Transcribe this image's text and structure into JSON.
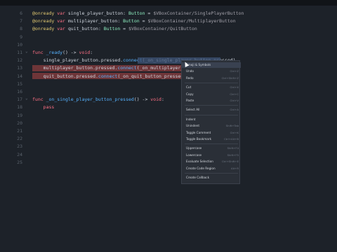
{
  "code_lines": [
    {
      "n": "6",
      "tokens": [
        {
          "c": "ann",
          "t": "@onready"
        },
        {
          "c": "sym",
          "t": " "
        },
        {
          "c": "kw",
          "t": "var"
        },
        {
          "c": "sym",
          "t": " single_player_button: "
        },
        {
          "c": "ty",
          "t": "Button"
        },
        {
          "c": "sym",
          "t": " = "
        },
        {
          "c": "str",
          "t": "$VBoxContainer/SinglePlayerButton"
        }
      ]
    },
    {
      "n": "7",
      "tokens": [
        {
          "c": "ann",
          "t": "@onready"
        },
        {
          "c": "sym",
          "t": " "
        },
        {
          "c": "kw",
          "t": "var"
        },
        {
          "c": "sym",
          "t": " multiplayer_button: "
        },
        {
          "c": "ty",
          "t": "Button"
        },
        {
          "c": "sym",
          "t": " = "
        },
        {
          "c": "str",
          "t": "$VBoxContainer/MultiplayerButton"
        }
      ]
    },
    {
      "n": "8",
      "tokens": [
        {
          "c": "ann",
          "t": "@onready"
        },
        {
          "c": "sym",
          "t": " "
        },
        {
          "c": "kw",
          "t": "var"
        },
        {
          "c": "sym",
          "t": " quit_button: "
        },
        {
          "c": "ty",
          "t": "Button"
        },
        {
          "c": "sym",
          "t": " = "
        },
        {
          "c": "str",
          "t": "$VBoxContainer/QuitButton"
        }
      ]
    },
    {
      "n": "9",
      "tokens": []
    },
    {
      "n": "10",
      "tokens": []
    },
    {
      "n": "11",
      "tokens": [
        {
          "c": "kw",
          "t": "func"
        },
        {
          "c": "sym",
          "t": " "
        },
        {
          "c": "fn",
          "t": "_ready"
        },
        {
          "c": "sym",
          "t": "() -> "
        },
        {
          "c": "kw",
          "t": "void"
        },
        {
          "c": "sym",
          "t": ":"
        }
      ]
    },
    {
      "n": "12",
      "tokens": [
        {
          "c": "sym",
          "t": "    single_player_button.pressed."
        },
        {
          "c": "fn",
          "t": "connect"
        },
        {
          "c": "sym",
          "t": "(_on_single_player_button_pressed)"
        }
      ]
    },
    {
      "n": "13",
      "tokens": [
        {
          "c": "sym",
          "t": "    multiplayer_button.pressed."
        },
        {
          "c": "fn",
          "t": "connect"
        },
        {
          "c": "sym",
          "t": "(_on_multiplayer_button_pressed)"
        }
      ]
    },
    {
      "n": "14",
      "tokens": [
        {
          "c": "sym",
          "t": "    quit_button.pressed."
        },
        {
          "c": "fn",
          "t": "connect"
        },
        {
          "c": "sym",
          "t": "(_on_quit_button_pressed)"
        }
      ]
    },
    {
      "n": "15",
      "tokens": []
    },
    {
      "n": "16",
      "tokens": []
    },
    {
      "n": "17",
      "tokens": [
        {
          "c": "kw",
          "t": "func"
        },
        {
          "c": "sym",
          "t": " "
        },
        {
          "c": "fn",
          "t": "_on_single_player_button_pressed"
        },
        {
          "c": "sym",
          "t": "() -> "
        },
        {
          "c": "kw",
          "t": "void"
        },
        {
          "c": "sym",
          "t": ":"
        }
      ]
    },
    {
      "n": "18",
      "tokens": [
        {
          "c": "kw",
          "t": "    pass"
        }
      ]
    },
    {
      "n": "19",
      "tokens": []
    },
    {
      "n": "20",
      "tokens": []
    },
    {
      "n": "21",
      "tokens": []
    },
    {
      "n": "22",
      "tokens": []
    },
    {
      "n": "23",
      "tokens": []
    },
    {
      "n": "24",
      "tokens": []
    },
    {
      "n": "25",
      "tokens": []
    }
  ],
  "context_menu": {
    "items": [
      {
        "label": "Emoji & Symbols",
        "shortcut": "",
        "sep_after": false
      },
      {
        "label": "Undo",
        "shortcut": "Ctrl+Z",
        "sep_after": false
      },
      {
        "label": "Redo",
        "shortcut": "Ctrl+Shift+Z",
        "sep_after": true
      },
      {
        "label": "Cut",
        "shortcut": "Ctrl+X",
        "sep_after": false
      },
      {
        "label": "Copy",
        "shortcut": "Ctrl+C",
        "sep_after": false
      },
      {
        "label": "Paste",
        "shortcut": "Ctrl+V",
        "sep_after": true
      },
      {
        "label": "Select All",
        "shortcut": "Ctrl+A",
        "sep_after": true
      },
      {
        "label": "Indent",
        "shortcut": "",
        "sep_after": false
      },
      {
        "label": "Unindent",
        "shortcut": "Shift+Tab",
        "sep_after": false
      },
      {
        "label": "Toggle Comment",
        "shortcut": "Ctrl+K",
        "sep_after": false
      },
      {
        "label": "Toggle Bookmark",
        "shortcut": "Ctrl+Alt+B",
        "sep_after": true
      },
      {
        "label": "Uppercase",
        "shortcut": "Shift+F4",
        "sep_after": false
      },
      {
        "label": "Lowercase",
        "shortcut": "Shift+F5",
        "sep_after": false
      },
      {
        "label": "Evaluate Selection",
        "shortcut": "Ctrl+Shift+E",
        "sep_after": false
      },
      {
        "label": "Create Code Region",
        "shortcut": "Alt+R",
        "sep_after": true
      },
      {
        "label": "Create Callback",
        "shortcut": "",
        "sep_after": false
      }
    ]
  },
  "colors": {
    "background": "#1d2229",
    "error_line": "#6e3538",
    "menu_bg": "#2a2f37"
  }
}
